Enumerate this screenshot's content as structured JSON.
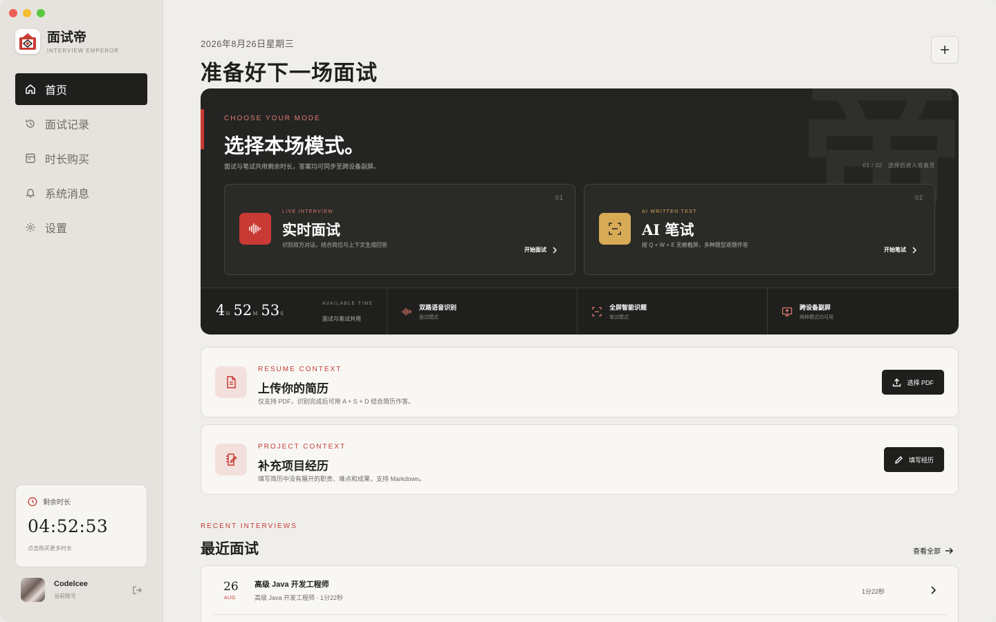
{
  "app": {
    "name": "面试帝",
    "subtitle": "INTERVIEW EMPEROR"
  },
  "sidebar": {
    "items": [
      {
        "label": "首页",
        "icon": "home-icon",
        "active": true
      },
      {
        "label": "面试记录",
        "icon": "history-icon",
        "active": false
      },
      {
        "label": "时长购买",
        "icon": "wallet-icon",
        "active": false
      },
      {
        "label": "系统消息",
        "icon": "bell-icon",
        "active": false
      },
      {
        "label": "设置",
        "icon": "gear-icon",
        "active": false
      }
    ],
    "time_card": {
      "label": "剩余时长",
      "value": "04:52:53",
      "hint": "点击购买更多时长"
    },
    "user": {
      "name": "Codelcee",
      "sub": "当前账号"
    }
  },
  "main": {
    "date": "2026年8月26日星期三",
    "title": "准备好下一场面试",
    "mode_card": {
      "eyebrow": "CHOOSE YOUR MODE",
      "title": "选择本场模式。",
      "desc": "面试与笔试共用剩余时长，答案均可同步至跨设备副屏。",
      "page": "01 / 02　选择后进入准备页",
      "watermark": "帝",
      "modes": [
        {
          "num": "01",
          "eyebrow": "LIVE INTERVIEW",
          "title": "实时面试",
          "desc": "识别双方对话，结合岗位与上下文生成回答",
          "cta": "开始面试"
        },
        {
          "num": "02",
          "eyebrow": "AI WRITTEN TEST",
          "title": "AI 笔试",
          "desc": "按 Q + W + E 无痕截屏，多种题型逐题作答",
          "cta": "开始笔试"
        }
      ],
      "available": {
        "h": "4",
        "h_unit": "H",
        "m": "52",
        "m_unit": "M",
        "s": "53",
        "s_unit": "S",
        "label": "AVAILABLE TIME",
        "sub": "面试与笔试共用"
      },
      "features": [
        {
          "title": "双路语音识别",
          "sub": "面试模式",
          "icon": "waveform-icon"
        },
        {
          "title": "全屏智能识题",
          "sub": "笔试模式",
          "icon": "scan-icon"
        },
        {
          "title": "跨设备副屏",
          "sub": "两种模式均可用",
          "icon": "screen-share-icon"
        }
      ]
    },
    "resume": {
      "eyebrow": "RESUME CONTEXT",
      "title": "上传你的简历",
      "desc": "仅支持 PDF，识别完成后可用 A + S + D 结合简历作答。",
      "button": "选择 PDF"
    },
    "project": {
      "eyebrow": "PROJECT CONTEXT",
      "title": "补充项目经历",
      "desc": "填写简历中没有展开的职责、难点和成果，支持 Markdown。",
      "button": "填写经历"
    },
    "recent": {
      "eyebrow": "RECENT INTERVIEWS",
      "title": "最近面试",
      "view_all": "查看全部",
      "rows": [
        {
          "day": "26",
          "month": "AUG",
          "title": "高级 Java 开发工程师",
          "sub": "高级 Java 开发工程师 · 1分22秒",
          "duration": "1分22秒"
        }
      ]
    }
  },
  "colors": {
    "accent_red": "#c83a33",
    "accent_gold": "#d7aa56",
    "dark": "#1f1f1d"
  }
}
